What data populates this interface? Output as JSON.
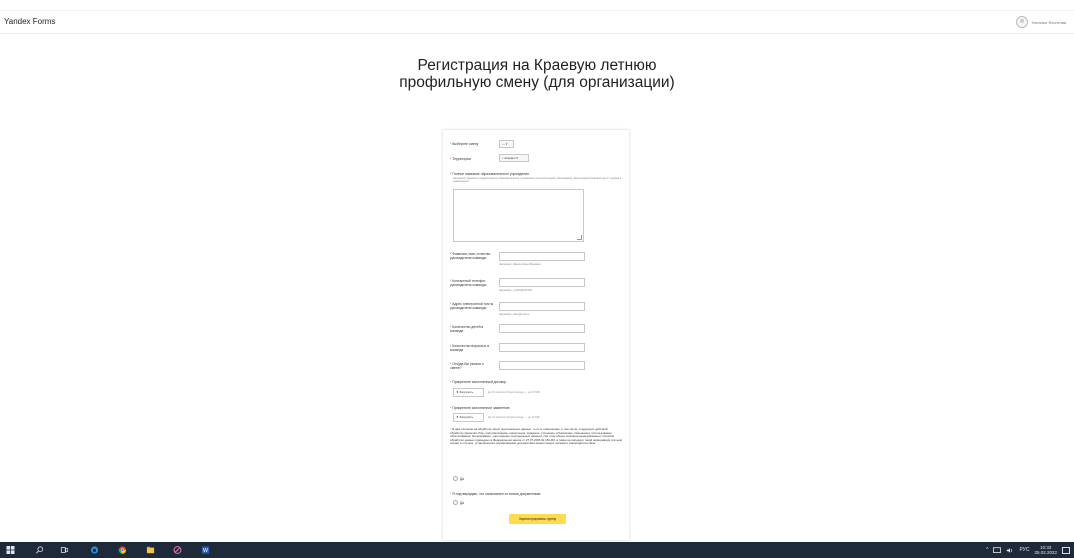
{
  "header": {
    "logo": "Yandex Forms",
    "user_name": "Наталья Яхонтова"
  },
  "page_title": "Регистрация на Краевую летнюю профильную смену (для организации)",
  "form": {
    "shift_label": "Выберите смену",
    "shift_value": "— ▾",
    "territory_label": "Территория",
    "territory_value": "г. Агаракл ▾",
    "org_label": "Полное название образовательного учреждения",
    "org_hint": "Например: Краевое государственное образовательное учреждение дополнительного образования \"Красноярский краевой центр туризма и краеведения\"",
    "leader_name_label": "Фамилия, имя, отчество руководителя команды",
    "leader_name_hint": "Например: Иванов Иван Иванович",
    "phone_label": "Контактный телефон руководителя команды",
    "phone_hint": "Например: +7(391)2234756",
    "email_label": "Адрес электронной почты руководителя команды",
    "email_hint": "Например: index@mail.ru",
    "children_label": "Количество детей в команде",
    "adults_label": "Количество взрослых в команде",
    "source_label": "Откуда Вы узнали о смене?",
    "contract_label": "Прикрепите заполненный договор",
    "upload_label": "Загрузить",
    "upload_hint": "До 10 файлов (общий размер — до 20 МБ)",
    "statement_label": "Прикрепите заполненное заявление",
    "consent_text": "Я даю согласие на обработку своих персональных данных, то есть совершение, в том числе, следующих действий: обработку (включая сбор, систематизацию, накопление, хранение, уточнение (обновление, изменение), использование, обезличивание, блокирование, уничтожение персональных данных), при этом общее описание вышеуказанных способов обработки данных приведено в Федеральном законе от 27.07.2006 № 152-ФЗ, а также на передачу такой информации третьим лицам, в случаях, установленных нормативными документами вышестоящих органов и законодательством.",
    "yes_label": "Да",
    "confirm_label": "Я подтверждаю, что ознакомлен со всеми документами",
    "submit_label": "Зарегистрировать группу"
  },
  "taskbar": {
    "lang": "РУС",
    "time": "10:33",
    "date": "25.02.2022"
  }
}
